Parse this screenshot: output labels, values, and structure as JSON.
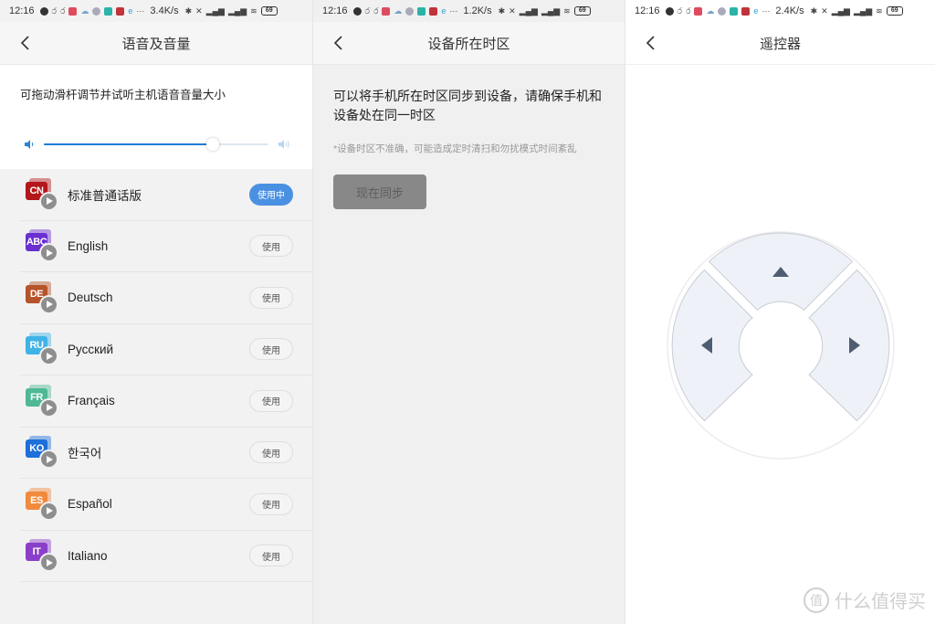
{
  "screens": [
    {
      "status_bar": {
        "time": "12:16",
        "speed": "3.4K/s",
        "battery": "69"
      },
      "nav": {
        "title": "语音及音量"
      },
      "volume": {
        "description": "可拖动滑杆调节并试听主机语音音量大小",
        "level_fraction": 0.75,
        "accent_color": "#1f7bd6"
      },
      "languages": [
        {
          "code": "CN",
          "name": "标准普通话版",
          "button": "使用中",
          "active": true,
          "color": "#b3161b"
        },
        {
          "code": "ABC",
          "name": "English",
          "button": "使用",
          "active": false,
          "color": "#6a2fd1"
        },
        {
          "code": "DE",
          "name": "Deutsch",
          "button": "使用",
          "active": false,
          "color": "#b5532a"
        },
        {
          "code": "RU",
          "name": "Русский",
          "button": "使用",
          "active": false,
          "color": "#3fb3e6"
        },
        {
          "code": "FR",
          "name": "Français",
          "button": "使用",
          "active": false,
          "color": "#4fb896"
        },
        {
          "code": "KO",
          "name": "한국어",
          "button": "使用",
          "active": false,
          "color": "#1e6fd9"
        },
        {
          "code": "ES",
          "name": "Español",
          "button": "使用",
          "active": false,
          "color": "#f08a3c"
        },
        {
          "code": "IT",
          "name": "Italiano",
          "button": "使用",
          "active": false,
          "color": "#8a3fc9"
        }
      ],
      "active_button_color": "#4a90e2"
    },
    {
      "status_bar": {
        "time": "12:16",
        "speed": "1.2K/s",
        "battery": "69"
      },
      "nav": {
        "title": "设备所在时区"
      },
      "timezone": {
        "main_text": "可以将手机所在时区同步到设备，请确保手机和设备处在同一时区",
        "note": "*设备时区不准确，可能造成定时清扫和勿扰模式时间紊乱",
        "sync_button": "现在同步"
      }
    },
    {
      "status_bar": {
        "time": "12:16",
        "speed": "2.4K/s",
        "battery": "69"
      },
      "nav": {
        "title": "遥控器"
      },
      "remote": {
        "buttons": [
          "up",
          "left",
          "right"
        ],
        "pad_color": "#eef1f8",
        "arrow_color": "#4f5d73"
      }
    }
  ],
  "watermark": {
    "icon_char": "值",
    "text": "什么值得买"
  }
}
